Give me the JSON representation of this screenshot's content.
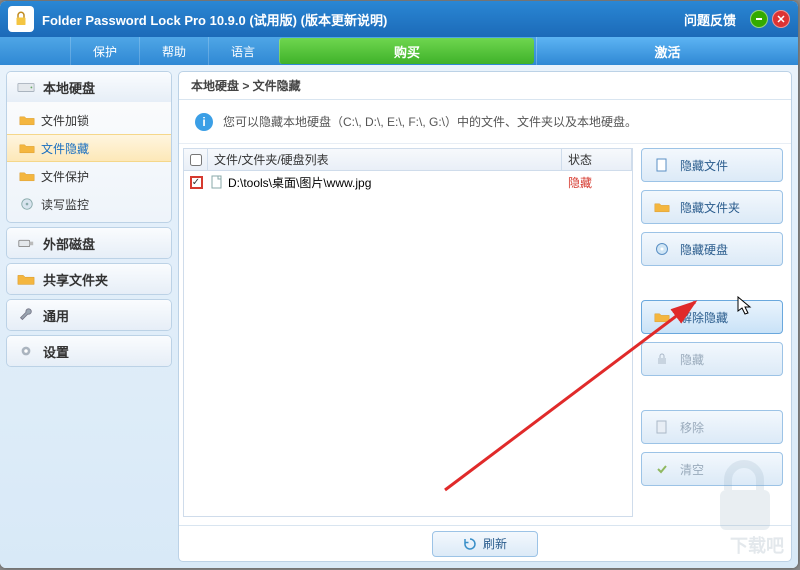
{
  "titlebar": {
    "app_name": "Folder Password Lock Pro 10.9.0 (试用版) (版本更新说明)",
    "feedback": "问题反馈"
  },
  "menubar": {
    "items": [
      "保护",
      "帮助",
      "语言"
    ],
    "buy": "购买",
    "activate": "激活"
  },
  "sidebar": {
    "groups": [
      {
        "title": "本地硬盘",
        "icon": "drive",
        "items": [
          {
            "label": "文件加锁",
            "icon": "folder"
          },
          {
            "label": "文件隐藏",
            "icon": "folder",
            "active": true
          },
          {
            "label": "文件保护",
            "icon": "folder"
          },
          {
            "label": "读写监控",
            "icon": "disc"
          }
        ]
      },
      {
        "title": "外部磁盘",
        "icon": "usb",
        "items": []
      },
      {
        "title": "共享文件夹",
        "icon": "folder",
        "items": []
      },
      {
        "title": "通用",
        "icon": "wrench",
        "items": []
      },
      {
        "title": "设置",
        "icon": "gear",
        "items": []
      }
    ]
  },
  "main": {
    "breadcrumb": "本地硬盘 > 文件隐藏",
    "info": "您可以隐藏本地硬盘（C:\\, D:\\, E:\\, F:\\, G:\\）中的文件、文件夹以及本地硬盘。",
    "table": {
      "header_chk": "",
      "header_path": "文件/文件夹/硬盘列表",
      "header_status": "状态",
      "rows": [
        {
          "checked": true,
          "path": "D:\\tools\\桌面\\图片\\www.jpg",
          "status": "隐藏"
        }
      ]
    },
    "actions": {
      "hide_file": "隐藏文件",
      "hide_folder": "隐藏文件夹",
      "hide_drive": "隐藏硬盘",
      "unhide": "解除隐藏",
      "hide": "隐藏",
      "remove": "移除",
      "clear": "清空"
    },
    "refresh": "刷新"
  }
}
